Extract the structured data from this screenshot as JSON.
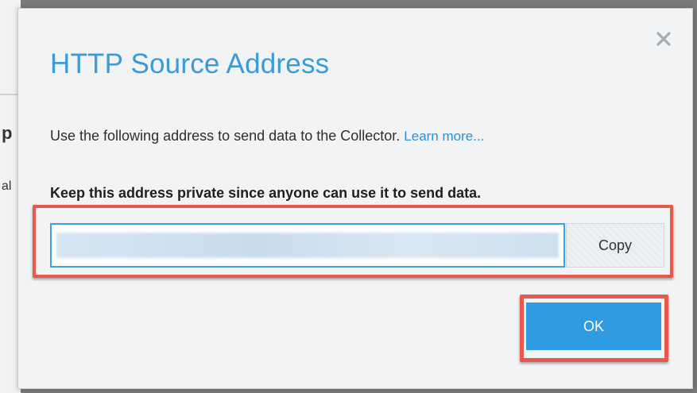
{
  "dialog": {
    "title": "HTTP Source Address",
    "description": "Use the following address to send data to the Collector.",
    "learn_more": "Learn more...",
    "warning": "Keep this address private since anyone can use it to send data.",
    "address_value": "",
    "copy_label": "Copy",
    "ok_label": "OK",
    "close_icon": "close-icon"
  },
  "background": {
    "fragments": [
      "p",
      "al"
    ]
  },
  "colors": {
    "title": "#3a9bd7",
    "link": "#2f8fd0",
    "primary_button": "#2e9be2",
    "highlight": "#e9594b",
    "dialog_bg": "#f1f3f5"
  }
}
